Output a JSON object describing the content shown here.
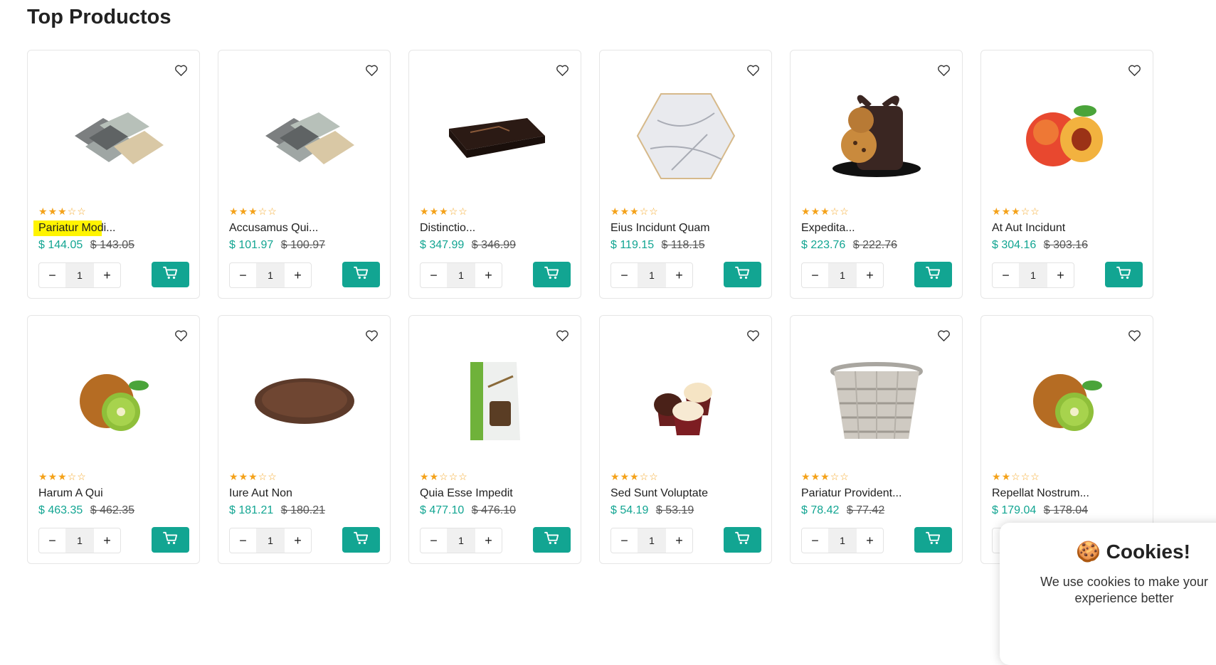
{
  "section": {
    "title": "Top Productos"
  },
  "products": [
    {
      "name": "Pariatur Modi...",
      "price": "$ 144.05",
      "old_price": "$ 143.05",
      "rating": 3,
      "qty": "1",
      "image": "tiles"
    },
    {
      "name": "Accusamus Qui...",
      "price": "$ 101.97",
      "old_price": "$ 100.97",
      "rating": 3,
      "qty": "1",
      "image": "tiles"
    },
    {
      "name": "Distinctio...",
      "price": "$ 347.99",
      "old_price": "$ 346.99",
      "rating": 3,
      "qty": "1",
      "image": "tray"
    },
    {
      "name": "Eius Incidunt Quam",
      "price": "$ 119.15",
      "old_price": "$ 118.15",
      "rating": 3,
      "qty": "1",
      "image": "marble-hexagon"
    },
    {
      "name": "Expedita...",
      "price": "$ 223.76",
      "old_price": "$ 222.76",
      "rating": 3,
      "qty": "1",
      "image": "cookies"
    },
    {
      "name": "At Aut Incidunt",
      "price": "$ 304.16",
      "old_price": "$ 303.16",
      "rating": 3,
      "qty": "1",
      "image": "peach"
    },
    {
      "name": "Harum A Qui",
      "price": "$ 463.35",
      "old_price": "$ 462.35",
      "rating": 3,
      "qty": "1",
      "image": "kiwi"
    },
    {
      "name": "Iure Aut Non",
      "price": "$ 181.21",
      "old_price": "$ 180.21",
      "rating": 3,
      "qty": "1",
      "image": "wooden-plate"
    },
    {
      "name": "Quia Esse Impedit",
      "price": "$ 477.10",
      "old_price": "$ 476.10",
      "rating": 2,
      "qty": "1",
      "image": "chocolate-bag"
    },
    {
      "name": "Sed Sunt Voluptate",
      "price": "$ 54.19",
      "old_price": "$ 53.19",
      "rating": 3,
      "qty": "1",
      "image": "cupcakes"
    },
    {
      "name": "Pariatur Provident...",
      "price": "$ 78.42",
      "old_price": "$ 77.42",
      "rating": 3,
      "qty": "1",
      "image": "basket"
    },
    {
      "name": "Repellat Nostrum...",
      "price": "$ 179.04",
      "old_price": "$ 178.04",
      "rating": 2,
      "qty": "1",
      "image": "kiwi"
    }
  ],
  "controls": {
    "minus": "−",
    "plus": "+"
  },
  "icons": {
    "wishlist": "heart-icon",
    "cart": "cart-icon"
  },
  "colors": {
    "accent": "#12a592",
    "star": "#f4a21a",
    "highlight": "#fff400"
  },
  "cookie_banner": {
    "emoji": "🍪",
    "title": "Cookies!",
    "text": "We use cookies to make your experience better"
  }
}
